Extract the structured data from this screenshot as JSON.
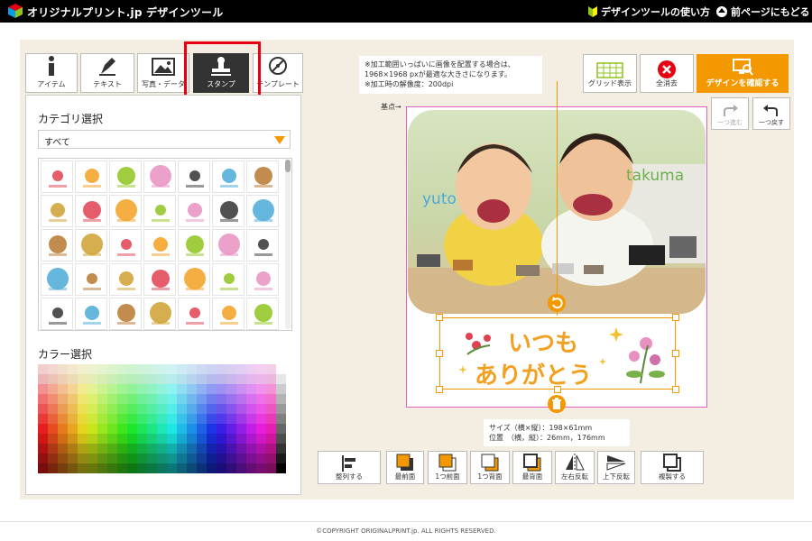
{
  "header": {
    "site_title": "オリジナルプリント.jp デザインツール",
    "howto_label": "デザインツールの使い方",
    "back_label": "前ページにもどる"
  },
  "tabs": [
    {
      "label": "アイテム",
      "icon": "info-icon"
    },
    {
      "label": "テキスト",
      "icon": "pen-icon"
    },
    {
      "label": "写真・データ",
      "icon": "image-icon"
    },
    {
      "label": "スタンプ",
      "icon": "stamp-icon",
      "selected": true
    },
    {
      "label": "テンプレート",
      "icon": "compass-icon"
    }
  ],
  "left_panel": {
    "category_title": "カテゴリ選択",
    "category_value": "すべて",
    "color_title": "カラー選択"
  },
  "note": {
    "line1": "※加工範囲いっぱいに画像を配置する場合は、",
    "line2": "1968×1968 pxが最適な大きさになります。",
    "line3": "※加工時の解像度：200dpi"
  },
  "toolbar": {
    "grid_label": "グリッド表示",
    "clear_label": "全消去",
    "confirm_label": "デザインを確認する",
    "redo_label": "一つ進む",
    "undo_label": "一つ戻す"
  },
  "canvas": {
    "base_point_label": "基点→",
    "name_left": "yuto",
    "name_right": "takuma",
    "stamp_line1": "いつも",
    "stamp_line2": "ありがとう"
  },
  "size_info": {
    "size_line": "サイズ（横×縦）：198×61mm",
    "position_line": "位置　（横，縦）：26mm，176mm"
  },
  "bottom_toolbar": [
    {
      "label": "整列する",
      "icon": "align-icon"
    },
    {
      "label": "最前面",
      "icon": "front-most-icon"
    },
    {
      "label": "1つ前面",
      "icon": "forward-icon"
    },
    {
      "label": "1つ背面",
      "icon": "backward-icon"
    },
    {
      "label": "最背面",
      "icon": "back-most-icon"
    },
    {
      "label": "左右反転",
      "icon": "flip-horizontal-icon"
    },
    {
      "label": "上下反転",
      "icon": "flip-vertical-icon"
    },
    {
      "label": "複製する",
      "icon": "duplicate-icon"
    }
  ],
  "footer": {
    "copyright": "©COPYRIGHT ORIGINALPRINT.jp. ALL RIGHTS RESERVED."
  },
  "colors": {
    "accent": "#f39800",
    "highlight": "#e60012",
    "selected_tab": "#333333",
    "panel_bg": "#f4ede1"
  }
}
